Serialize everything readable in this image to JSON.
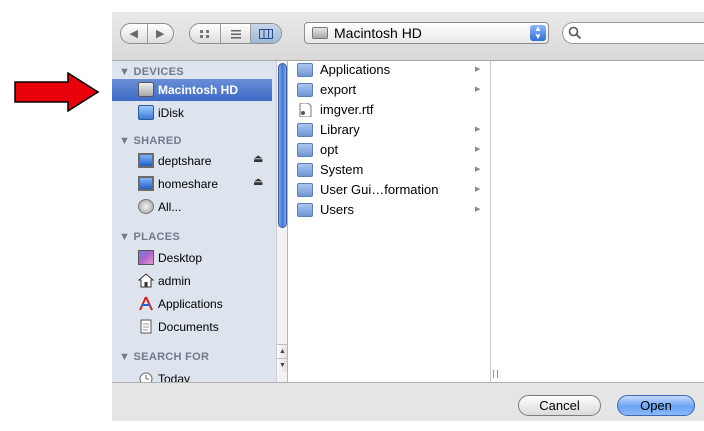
{
  "toolbar": {
    "back_icon": "back-arrow-icon",
    "forward_icon": "forward-arrow-icon",
    "view_modes": [
      "icon-view",
      "list-view",
      "column-view"
    ],
    "selected_view": "column-view",
    "location": "Macintosh HD",
    "search_value": ""
  },
  "sidebar": {
    "devices_header": "DEVICES",
    "devices": [
      {
        "label": "Macintosh HD",
        "icon": "hard-disk-icon",
        "selected": true
      },
      {
        "label": "iDisk",
        "icon": "idisk-icon"
      }
    ],
    "shared_header": "SHARED",
    "shared": [
      {
        "label": "deptshare",
        "icon": "network-computer-icon",
        "eject": "⏏"
      },
      {
        "label": "homeshare",
        "icon": "network-computer-icon",
        "eject": "⏏"
      },
      {
        "label": "All...",
        "icon": "network-globe-icon"
      }
    ],
    "places_header": "PLACES",
    "places": [
      {
        "label": "Desktop",
        "icon": "desktop-icon"
      },
      {
        "label": "admin",
        "icon": "home-icon"
      },
      {
        "label": "Applications",
        "icon": "applications-icon"
      },
      {
        "label": "Documents",
        "icon": "documents-icon"
      }
    ],
    "search_header": "SEARCH FOR",
    "search_for": [
      {
        "label": "Today",
        "icon": "clock-icon"
      }
    ]
  },
  "browser": {
    "column1": [
      {
        "label": "Applications",
        "icon": "applications-folder-icon",
        "has_children": true
      },
      {
        "label": "export",
        "icon": "folder-icon",
        "has_children": true
      },
      {
        "label": "imgver.rtf",
        "icon": "rtf-document-icon",
        "has_children": false
      },
      {
        "label": "Library",
        "icon": "library-folder-icon",
        "has_children": true
      },
      {
        "label": "opt",
        "icon": "folder-icon",
        "has_children": true
      },
      {
        "label": "System",
        "icon": "system-folder-icon",
        "has_children": true
      },
      {
        "label": "User Gui…formation",
        "icon": "user-guides-folder-icon",
        "has_children": true
      },
      {
        "label": "Users",
        "icon": "users-folder-icon",
        "has_children": true
      }
    ],
    "chevron": "▶",
    "column_resize_grip": "||"
  },
  "buttons": {
    "cancel": "Cancel",
    "open": "Open"
  },
  "annotation": {
    "arrow_color": "#e8000b",
    "points_to": "Macintosh HD"
  },
  "colors": {
    "selection": "#3e6bc7",
    "sidebar_bg": "#dde4ed",
    "default_button": "#6aa3f3"
  }
}
